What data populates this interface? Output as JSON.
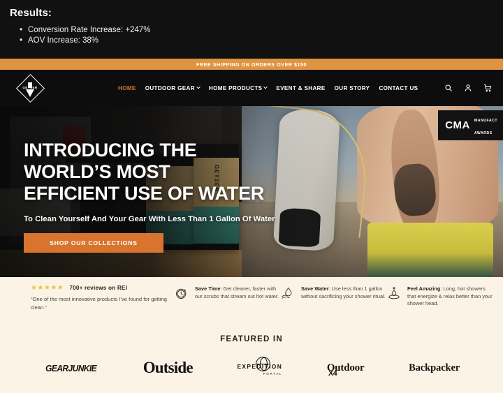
{
  "results": {
    "title": "Results:",
    "items": [
      "Conversion Rate Increase: +247%",
      "AOV Increase: 38%"
    ]
  },
  "announcement": {
    "text": "FREE SHIPPING ON ORDERS OVER $150",
    "bg_color": "#de9440"
  },
  "header": {
    "logo_text": "GEYSER",
    "nav": [
      {
        "label": "HOME",
        "has_chevron": false,
        "active": true
      },
      {
        "label": "OUTDOOR GEAR",
        "has_chevron": true,
        "active": false
      },
      {
        "label": "HOME PRODUCTS",
        "has_chevron": true,
        "active": false
      },
      {
        "label": "EVENT & SHARE",
        "has_chevron": false,
        "active": false
      },
      {
        "label": "OUR STORY",
        "has_chevron": false,
        "active": false
      },
      {
        "label": "CONTACT US",
        "has_chevron": false,
        "active": false
      }
    ],
    "icons": [
      "search-icon",
      "account-icon",
      "cart-icon"
    ],
    "active_color": "#d9742e"
  },
  "hero": {
    "title_line1": "INTRODUCING THE",
    "title_line2": "WORLD’S MOST",
    "title_line3": "EFFICIENT USE OF WATER",
    "subtitle": "To Clean Yourself And Your Gear With Less Than 1 Gallon Of Water",
    "cta_label": "SHOP OUR COLLECTIONS",
    "cta_color": "#d9742e",
    "badge": {
      "name": "CMA",
      "line1": "MANUFACT",
      "line2": "AWARDS"
    },
    "product_label": "GEYSER"
  },
  "benefits": {
    "reviews": {
      "stars": "★★★★★",
      "count_label": "700+ reviews on REI",
      "quote": "“One of the most innovative products I’ve found for getting clean.”",
      "star_color": "#e8c44a"
    },
    "items": [
      {
        "icon": "stopwatch-icon",
        "title": "Save Time",
        "text": ": Get cleaner, faster with our scrubs that stream out hot water."
      },
      {
        "icon": "water-drop-hand-icon",
        "title": "Save Water",
        "text": ": Use less than 1 gallon without sacrificing your shower ritual."
      },
      {
        "icon": "droplet-splash-icon",
        "title": "Feel Amazing",
        "text": ": Long, hot showers that energize & relax better than your shower head."
      }
    ]
  },
  "featured": {
    "title": "FEATURED IN",
    "background": "#fbf4e6",
    "brands": [
      {
        "name": "GEARJUNKIE"
      },
      {
        "name": "Outside"
      },
      {
        "name": "EXPEDITION",
        "sub": "PORTAL"
      },
      {
        "name": "Outdoor",
        "sub": "X4"
      },
      {
        "name": "Backpacker"
      }
    ]
  }
}
